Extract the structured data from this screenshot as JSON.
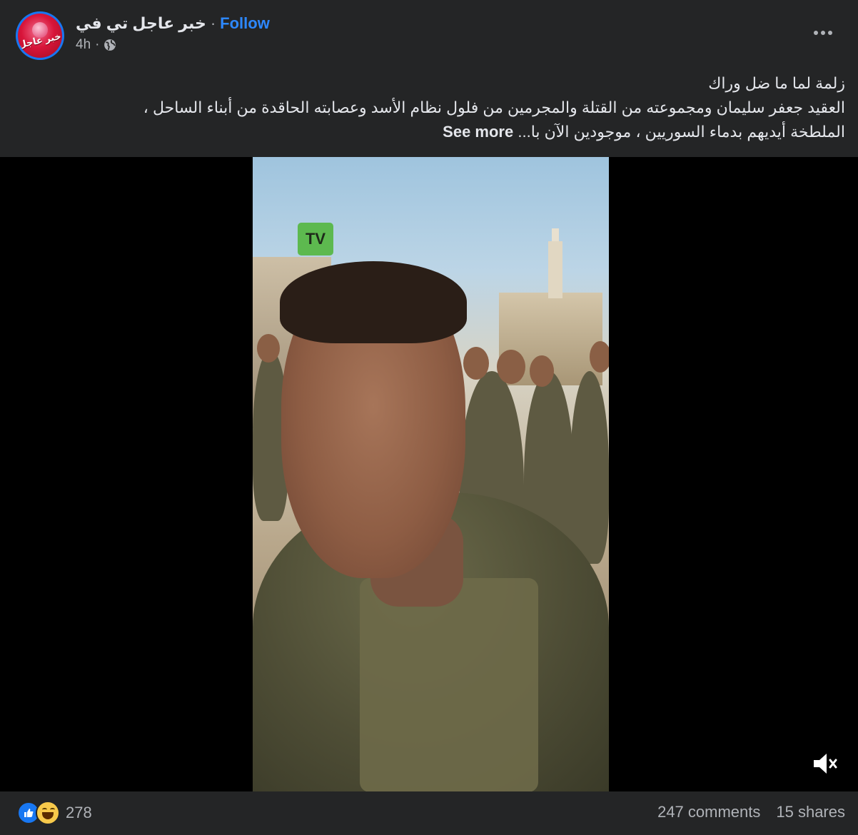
{
  "header": {
    "page_name": "خبر عاجل تي في",
    "separator": "·",
    "follow_label": "Follow",
    "time": "4h",
    "meta_separator": "·",
    "avatar_logo_text": "خبر عاجل",
    "privacy_icon": "globe-icon",
    "more_icon": "more-options-icon"
  },
  "post": {
    "line1": "زلمة لما ما ضل وراك",
    "line2": "العقيد جعفر سليمان ومجموعته من القتلة والمجرمين من فلول نظام الأسد وعصابته الحاقدة من أبناء الساحل ،",
    "line3": "الملطخة أيديهم بدماء السوريين ، موجودين الآن با...",
    "see_more": "See more"
  },
  "video": {
    "watermark": "TV",
    "mute_icon": "volume-muted-icon"
  },
  "footer": {
    "reaction_icons": [
      "like-icon",
      "haha-icon"
    ],
    "reaction_count": "278",
    "comments": "247 comments",
    "shares": "15 shares"
  },
  "colors": {
    "background": "#242526",
    "text_primary": "#e4e6eb",
    "text_secondary": "#b0b3b8",
    "accent": "#2d88ff",
    "like_blue": "#1877f2"
  }
}
